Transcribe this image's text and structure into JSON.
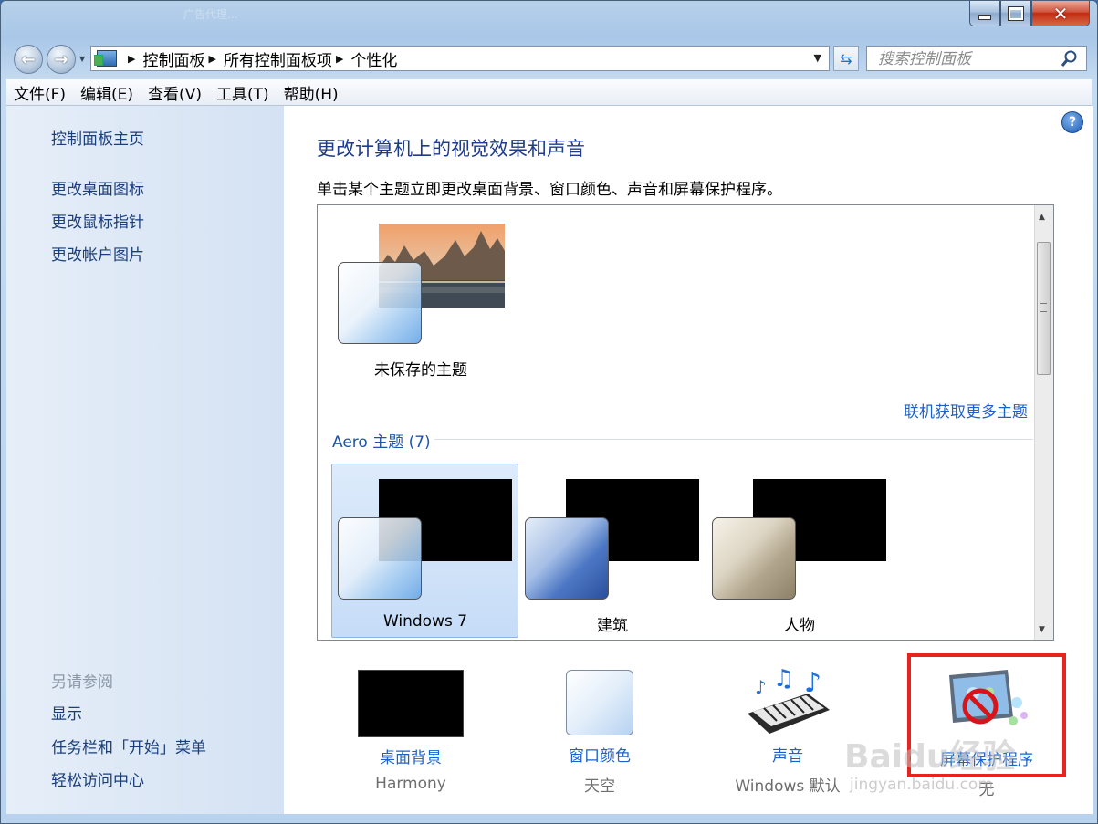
{
  "window": {
    "title": "广告代理..."
  },
  "address": {
    "crumbs": [
      "控制面板",
      "所有控制面板项",
      "个性化"
    ]
  },
  "search": {
    "placeholder": "搜索控制面板"
  },
  "menu": [
    "文件(F)",
    "编辑(E)",
    "查看(V)",
    "工具(T)",
    "帮助(H)"
  ],
  "left": {
    "home": "控制面板主页",
    "links": [
      "更改桌面图标",
      "更改鼠标指针",
      "更改帐户图片"
    ],
    "see_also_label": "另请参阅",
    "see_also": [
      "显示",
      "任务栏和「开始」菜单",
      "轻松访问中心"
    ]
  },
  "main": {
    "title": "更改计算机上的视觉效果和声音",
    "description": "单击某个主题立即更改桌面背景、窗口颜色、声音和屏幕保护程序。",
    "my_theme": "未保存的主题",
    "online_link": "联机获取更多主题",
    "aero_section": "Aero 主题 (7)",
    "themes": [
      "Windows 7",
      "建筑",
      "人物"
    ]
  },
  "bottom": [
    {
      "label": "桌面背景",
      "sub": "Harmony"
    },
    {
      "label": "窗口颜色",
      "sub": "天空"
    },
    {
      "label": "声音",
      "sub": "Windows 默认"
    },
    {
      "label": "屏幕保护程序",
      "sub": "无"
    }
  ],
  "watermark": {
    "brand": "Baidu经验",
    "url": "jingyan.baidu.com"
  },
  "colors": {
    "link": "#1e62c8",
    "title": "#1e3c8a",
    "highlight_box": "#e8221c"
  }
}
